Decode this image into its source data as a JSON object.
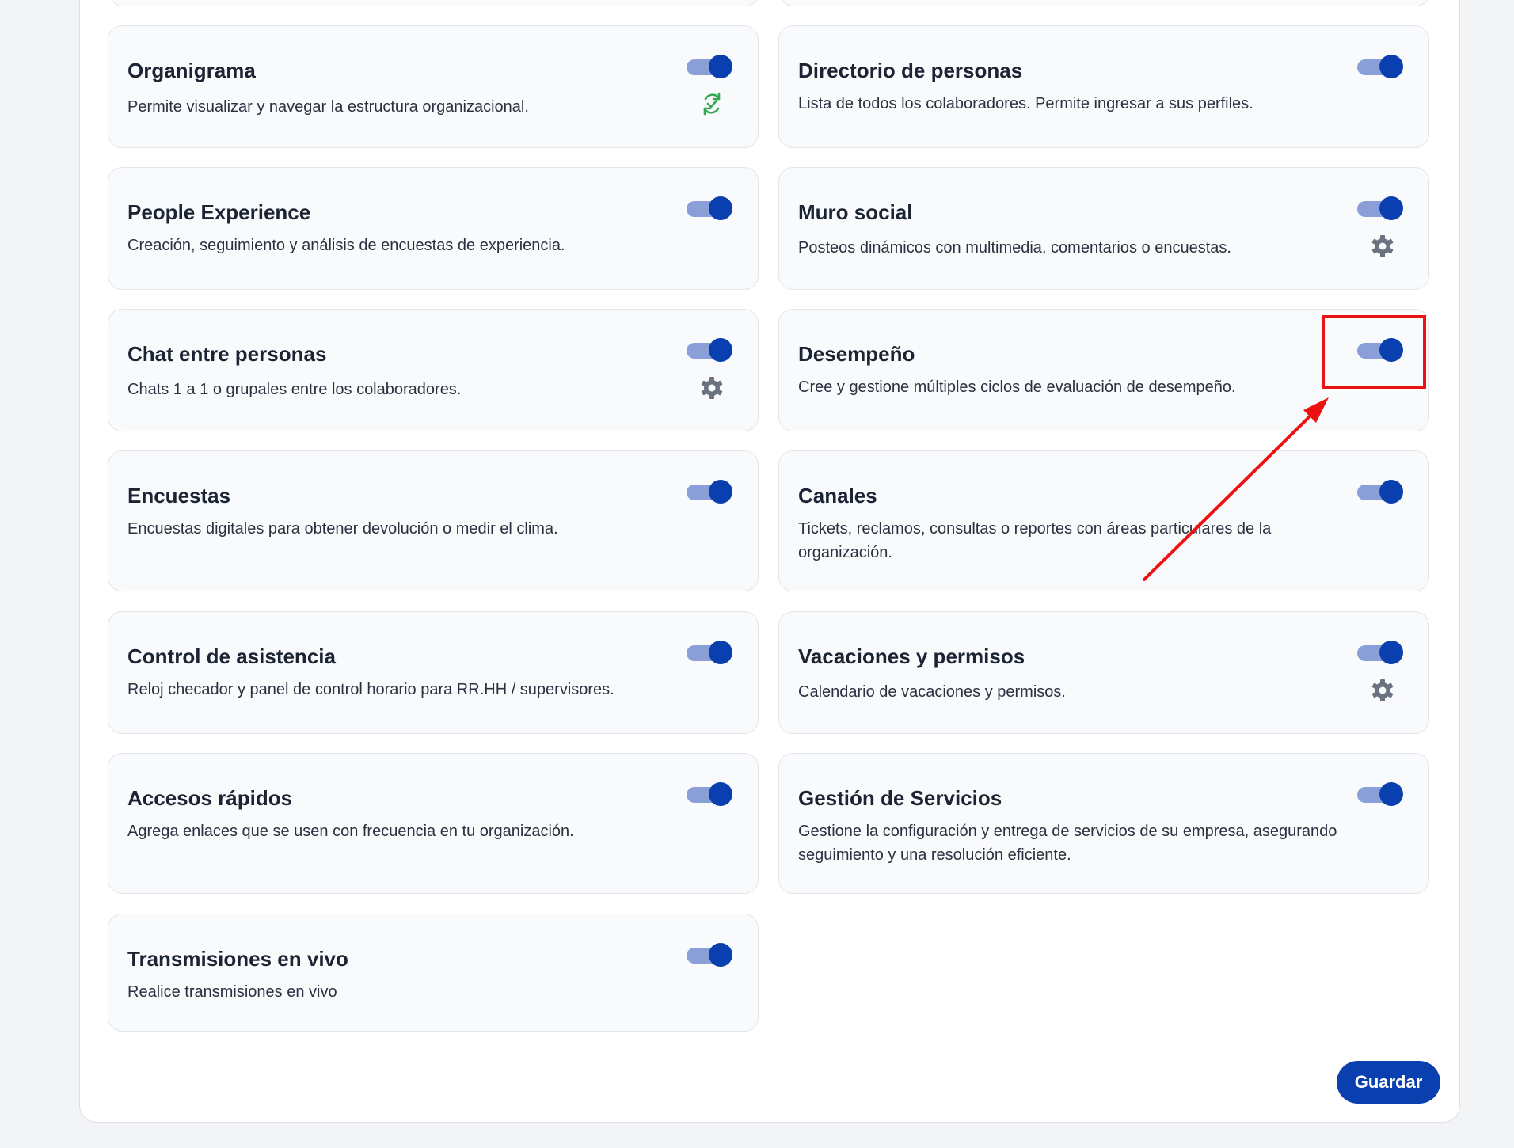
{
  "save_label": "Guardar",
  "colors": {
    "accent": "#0a3fb0",
    "toggle_track": "#8a9fd8",
    "sync_icon": "#34a853",
    "gear_icon": "#6b7280",
    "annotation": "#ee1111"
  },
  "modules": [
    {
      "title": "Organigrama",
      "description": "Permite visualizar y navegar la estructura organizacional.",
      "enabled": true,
      "action_icon": "sync-check-icon"
    },
    {
      "title": "Directorio de personas",
      "description": "Lista de todos los colaboradores. Permite ingresar a sus perfiles.",
      "enabled": true
    },
    {
      "title": "People Experience",
      "description": "Creación, seguimiento y análisis de encuestas de experiencia.",
      "enabled": true
    },
    {
      "title": "Muro social",
      "description": "Posteos dinámicos con multimedia, comentarios o encuestas.",
      "enabled": true,
      "action_icon": "gear-icon"
    },
    {
      "title": "Chat entre personas",
      "description": "Chats 1 a 1 o grupales entre los colaboradores.",
      "enabled": true,
      "action_icon": "gear-icon"
    },
    {
      "title": "Desempeño",
      "description": "Cree y gestione múltiples ciclos de evaluación de desempeño.",
      "enabled": true,
      "highlighted": true
    },
    {
      "title": "Encuestas",
      "description": "Encuestas digitales para obtener devolución o medir el clima.",
      "enabled": true
    },
    {
      "title": "Canales",
      "description": "Tickets, reclamos, consultas o reportes con áreas particulares de la organización.",
      "enabled": true
    },
    {
      "title": "Control de asistencia",
      "description": "Reloj checador y panel de control horario para RR.HH / supervisores.",
      "enabled": true
    },
    {
      "title": "Vacaciones y permisos",
      "description": "Calendario de vacaciones y permisos.",
      "enabled": true,
      "action_icon": "gear-icon"
    },
    {
      "title": "Accesos rápidos",
      "description": "Agrega enlaces que se usen con frecuencia en tu organización.",
      "enabled": true
    },
    {
      "title": "Gestión de Servicios",
      "description": "Gestione la configuración y entrega de servicios de su empresa, asegurando seguimiento y una resolución eficiente.",
      "enabled": true
    },
    {
      "title": "Transmisiones en vivo",
      "description": "Realice transmisiones en vivo",
      "enabled": true
    }
  ]
}
